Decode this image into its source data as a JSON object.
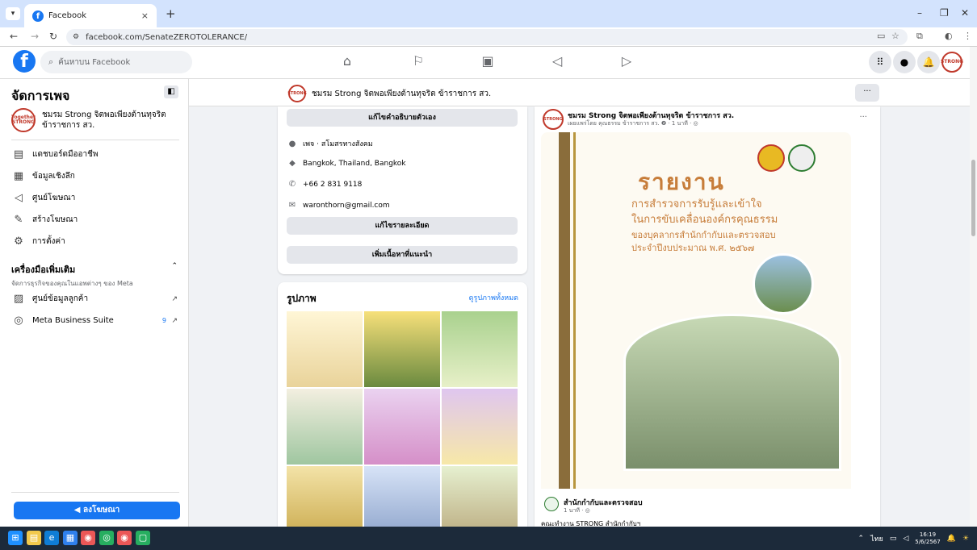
{
  "browser": {
    "tab_title": "Facebook",
    "tab_close": "×",
    "new_tab": "+",
    "url": "facebook.com/SenateZEROTOLERANCE/",
    "minimize": "–",
    "restore": "❐",
    "close": "✕"
  },
  "fb_header": {
    "search_placeholder": "ค้นหาบน Facebook"
  },
  "sidebar": {
    "title": "จัดการเพจ",
    "page_name": "ชมรม Strong จิตพอเพียงต้านทุจริต ข้าราชการ สว.",
    "items": [
      {
        "label": "แดชบอร์ดมืออาชีพ",
        "icon": "dashboard-icon"
      },
      {
        "label": "ข้อมูลเชิงลึก",
        "icon": "insights-icon"
      },
      {
        "label": "ศูนย์โฆษณา",
        "icon": "megaphone-icon"
      },
      {
        "label": "สร้างโฆษณา",
        "icon": "pencil-icon"
      },
      {
        "label": "การตั้งค่า",
        "icon": "gear-icon"
      }
    ],
    "tools_title": "เครื่องมือเพิ่มเติม",
    "tools_subtitle": "จัดการธุรกิจของคุณในแอพต่างๆ ของ Meta",
    "tool_items": [
      {
        "label": "ศูนย์ข้อมูลลูกค้า"
      },
      {
        "label": "Meta Business Suite",
        "badge": "9"
      }
    ],
    "advertise_label": "ลงโฆษณา"
  },
  "page_header": {
    "name": "ชมรม Strong จิตพอเพียงต้านทุจริต ข้าราชการ สว.",
    "more": "···"
  },
  "intro": {
    "edit_bio": "แก้ไขคำอธิบายตัวเอง",
    "category": "เพจ · สโมสรทางสังคม",
    "location": "Bangkok, Thailand, Bangkok",
    "phone": "+66 2 831 9118",
    "email": "waronthorn@gmail.com",
    "edit_details": "แก้ไขรายละเอียด",
    "add_featured": "เพิ่มเนื้อหาที่แนะนำ"
  },
  "photos": {
    "title": "รูปภาพ",
    "see_all": "ดูรูปภาพทั้งหมด"
  },
  "post": {
    "author": "ชมรม Strong จิตพอเพียงต้านทุจริต ข้าราชการ สว.",
    "meta": "เผยแพร่โดย คุณธรรม ข้าราชการ สว. ❷ · 1 นาที · ◎",
    "more": "···",
    "image_title": "รายงาน",
    "image_lines": [
      "การสำรวจการรับรู้และเข้าใจ",
      "ในการขับเคลื่อนองค์กรคุณธรรม",
      "ของบุคลากรสำนักกำกับและตรวจสอบ",
      "ประจำปีงบประมาณ พ.ศ. ๒๕๖๗"
    ],
    "shared_page": "สำนักกำกับและตรวจสอบ",
    "shared_time": "1 นาที · ◎",
    "shared_text": "คณะทำงาน STRONG สำนักกำกับฯ"
  },
  "taskbar": {
    "lang": "ไทย",
    "time": "16:19",
    "date": "5/6/2567"
  },
  "colors": {
    "brand": "#1877f2",
    "accent_gold": "#c77d3a"
  }
}
